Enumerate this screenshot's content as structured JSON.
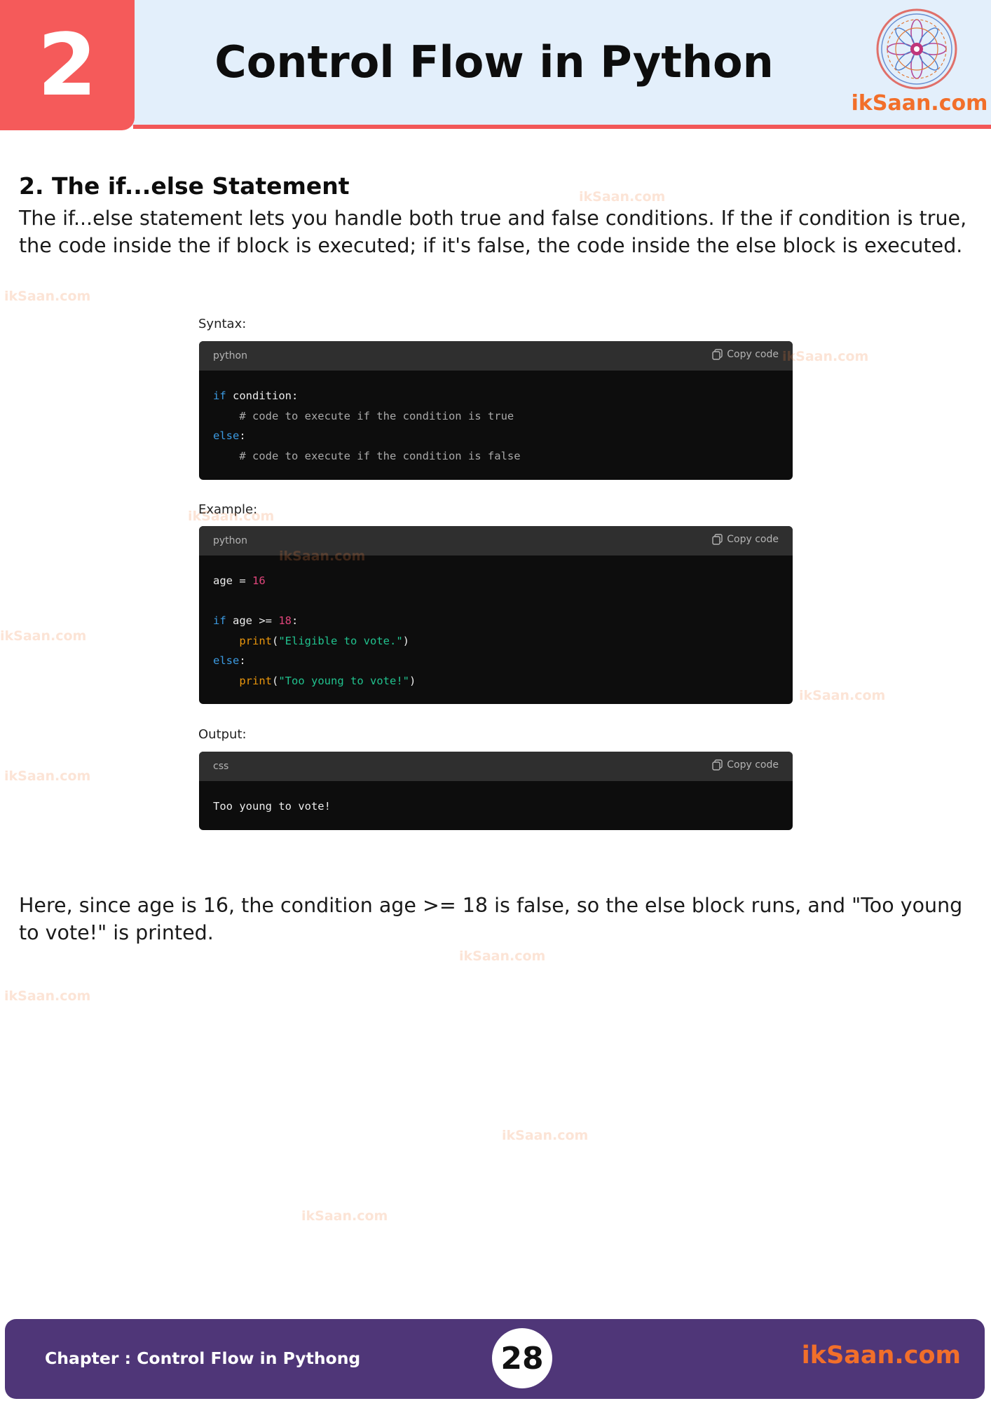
{
  "header": {
    "chapter_number": "2",
    "title": "Control Flow in Python",
    "brand": "ikSaan.com"
  },
  "colors": {
    "accent_red": "#f55a5a",
    "header_bg": "#e3effb",
    "brand_orange": "#f26f2a",
    "footer_purple": "#4f3678",
    "code_bg": "#0d0d0d"
  },
  "section": {
    "title": "2. The if...else Statement",
    "intro": "The if...else statement lets you handle both true and false conditions. If the if condition is true, the code inside the if block is executed; if it's false, the code inside the else block is executed.",
    "syntax_label": "Syntax:",
    "example_label": "Example:",
    "output_label": "Output:",
    "explanation": "Here, since age is 16, the condition age >= 18 is false, so the else block runs, and \"Too young to vote!\" is printed."
  },
  "code_blocks": {
    "syntax": {
      "language": "python",
      "copy_label": "Copy code",
      "tokens": {
        "if_kw": "if",
        "condition": "condition:",
        "comment_true": "# code to execute if the condition is true",
        "else_kw": "else",
        "colon": ":",
        "comment_false": "# code to execute if the condition is false"
      }
    },
    "example": {
      "language": "python",
      "copy_label": "Copy code",
      "tokens": {
        "var": "age",
        "assign": " = ",
        "value": "16",
        "if_kw": "if",
        "cond_mid": " age >= ",
        "threshold": "18",
        "colon": ":",
        "print_fn": "print",
        "open_paren": "(",
        "str_true": "\"Eligible to vote.\"",
        "close_paren": ")",
        "else_kw": "else",
        "str_false": "\"Too young to vote!\""
      }
    },
    "output": {
      "language": "css",
      "copy_label": "Copy code",
      "text": "Too young to vote!"
    }
  },
  "watermark": "ikSaan.com",
  "footer": {
    "chapter_label": "Chapter : Control Flow in Pythong",
    "page_number": "28",
    "brand": "ikSaan.com"
  }
}
